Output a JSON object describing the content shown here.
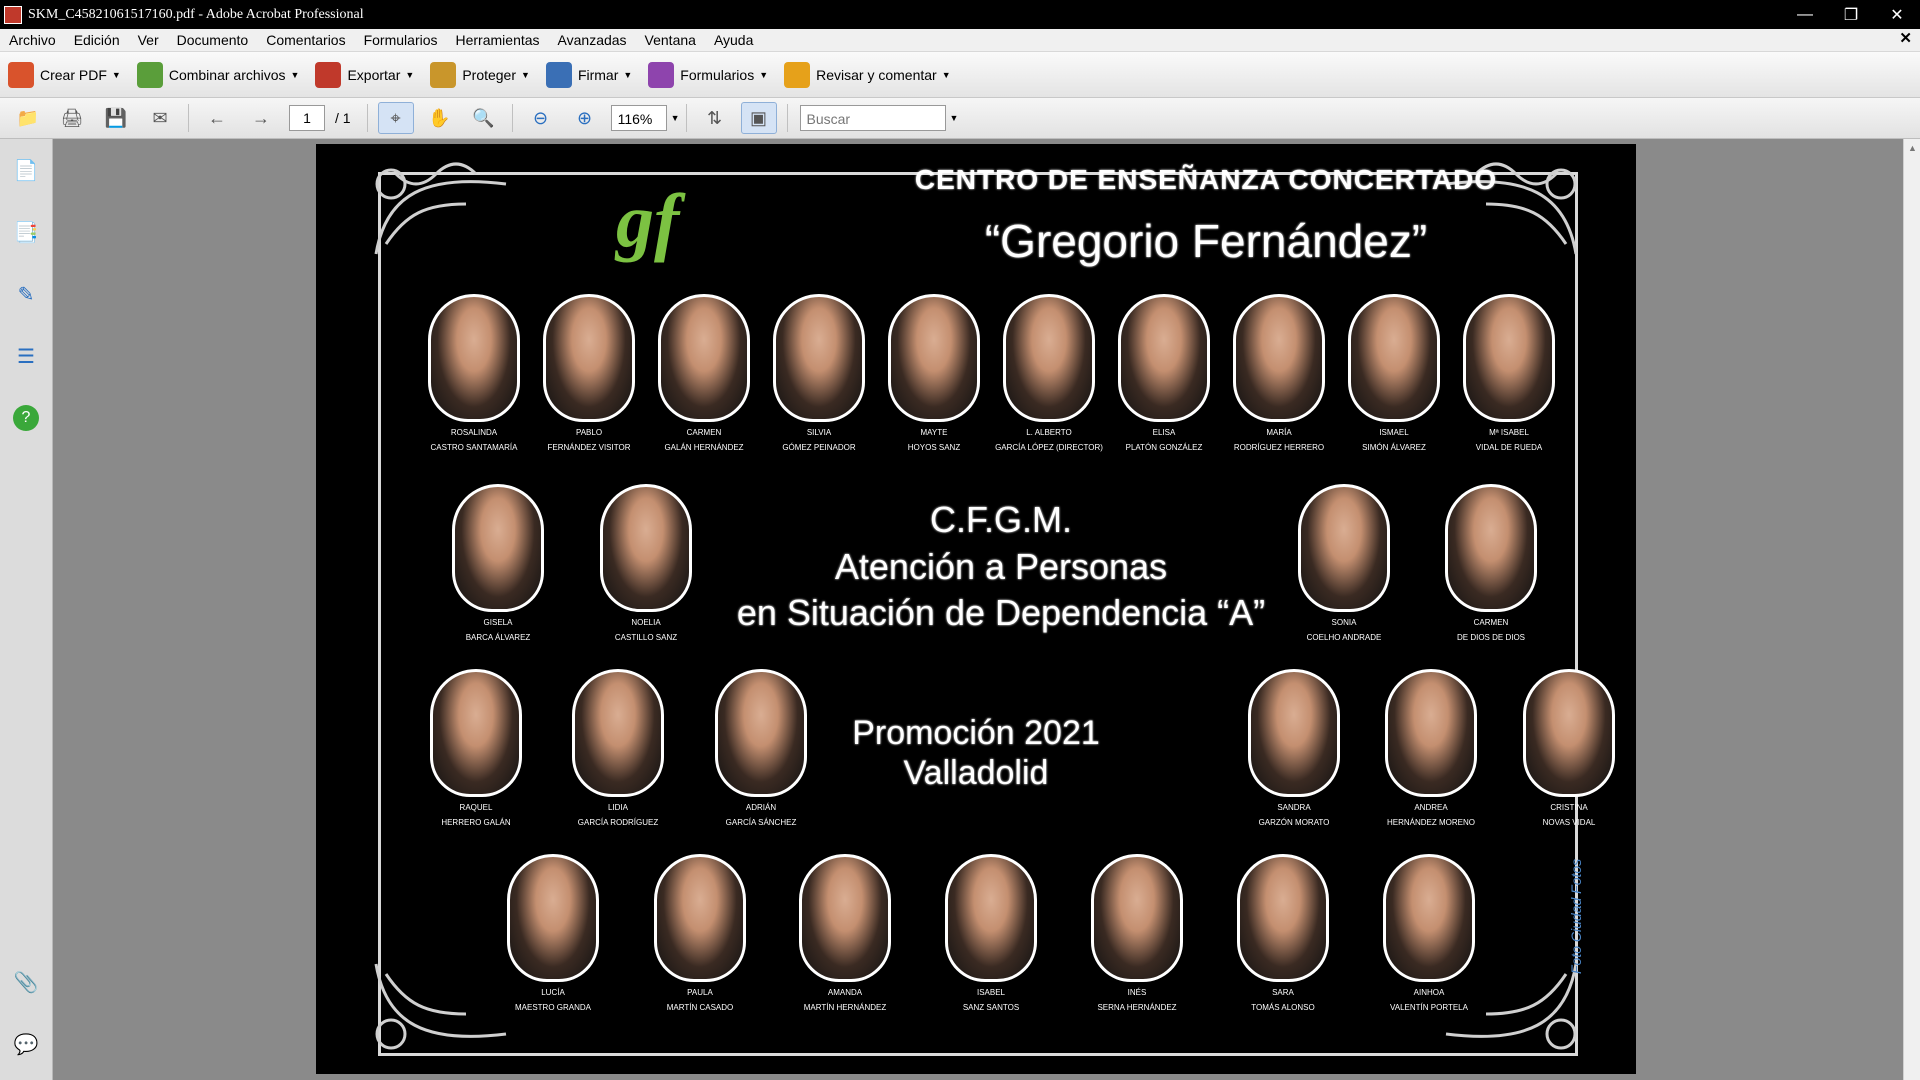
{
  "window": {
    "title": "SKM_C45821061517160.pdf - Adobe Acrobat Professional",
    "controls": [
      "minimize",
      "maximize",
      "close"
    ]
  },
  "menu": [
    "Archivo",
    "Edición",
    "Ver",
    "Documento",
    "Comentarios",
    "Formularios",
    "Herramientas",
    "Avanzadas",
    "Ventana",
    "Ayuda"
  ],
  "toolbar1": [
    {
      "label": "Crear PDF",
      "icon": "create-pdf-icon",
      "color": "#d9532c"
    },
    {
      "label": "Combinar archivos",
      "icon": "combine-files-icon",
      "color": "#5a9e3a"
    },
    {
      "label": "Exportar",
      "icon": "export-icon",
      "color": "#c0392b"
    },
    {
      "label": "Proteger",
      "icon": "lock-icon",
      "color": "#c9962b"
    },
    {
      "label": "Firmar",
      "icon": "pen-icon",
      "color": "#3a6fb5"
    },
    {
      "label": "Formularios",
      "icon": "forms-icon",
      "color": "#8e44ad"
    },
    {
      "label": "Revisar y comentar",
      "icon": "comment-icon",
      "color": "#e6a11a"
    }
  ],
  "toolbar2": {
    "page_current": "1",
    "page_total": "/ 1",
    "zoom": "116%",
    "search_placeholder": "Buscar"
  },
  "document": {
    "school": "CENTRO DE ENSEÑANZA CONCERTADO",
    "name": "“Gregorio Fernández”",
    "logo": "gf",
    "course_line1": "C.F.G.M.",
    "course_line2": "Atención a Personas",
    "course_line3": "en Situación de Dependencia “A”",
    "promo": "Promoción 2021",
    "city": "Valladolid",
    "credit": "Foto Ciudad Fotos",
    "teachers": [
      {
        "first": "Rosalinda",
        "last": "CASTRO SANTAMARÍA"
      },
      {
        "first": "Pablo",
        "last": "FERNÁNDEZ VISITOR"
      },
      {
        "first": "Carmen",
        "last": "GALÁN HERNÁNDEZ"
      },
      {
        "first": "Silvia",
        "last": "GÓMEZ PEINADOR"
      },
      {
        "first": "Mayte",
        "last": "HOYOS SANZ"
      },
      {
        "first": "L. Alberto",
        "last": "GARCÍA LÓPEZ (Director)"
      },
      {
        "first": "Elisa",
        "last": "PLATÓN GONZÁLEZ"
      },
      {
        "first": "María",
        "last": "RODRÍGUEZ HERRERO"
      },
      {
        "first": "Ismael",
        "last": "SIMÓN ÁLVAREZ"
      },
      {
        "first": "Mª Isabel",
        "last": "VIDAL DE RUEDA"
      }
    ],
    "row2": [
      {
        "first": "Gisela",
        "last": "BARCA ÁLVAREZ"
      },
      {
        "first": "Noelia",
        "last": "CASTILLO SANZ"
      },
      {
        "first": "Sonia",
        "last": "COELHO ANDRADE"
      },
      {
        "first": "Carmen",
        "last": "DE DIOS DE DIOS"
      }
    ],
    "row3": [
      {
        "first": "Raquel",
        "last": "HERRERO GALÁN"
      },
      {
        "first": "Lidia",
        "last": "GARCÍA RODRÍGUEZ"
      },
      {
        "first": "Adrián",
        "last": "GARCÍA SÁNCHEZ"
      },
      {
        "first": "Sandra",
        "last": "GARZÓN MORATO"
      },
      {
        "first": "Andrea",
        "last": "HERNÁNDEZ MORENO"
      },
      {
        "first": "Cristina",
        "last": "NOVAS VIDAL"
      }
    ],
    "row4": [
      {
        "first": "Lucía",
        "last": "MAESTRO GRANDA"
      },
      {
        "first": "Paula",
        "last": "MARTÍN CASADO"
      },
      {
        "first": "Amanda",
        "last": "MARTÍN HERNÁNDEZ"
      },
      {
        "first": "Isabel",
        "last": "SANZ SANTOS"
      },
      {
        "first": "Inés",
        "last": "SERNA HERNÁNDEZ"
      },
      {
        "first": "Sara",
        "last": "TOMÁS ALONSO"
      },
      {
        "first": "Ainhoa",
        "last": "VALENTÍN PORTELA"
      }
    ]
  }
}
